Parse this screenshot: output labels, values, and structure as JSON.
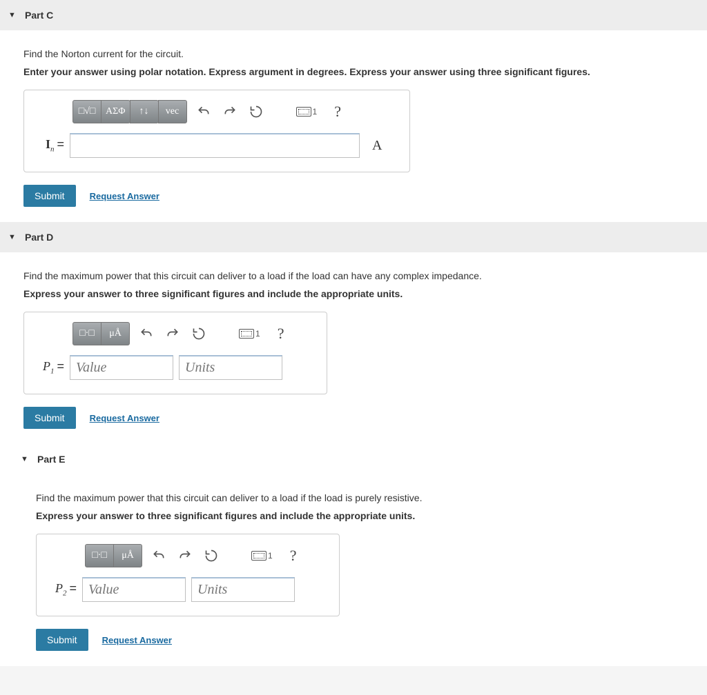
{
  "parts": {
    "c": {
      "title": "Part C",
      "question": "Find the Norton current for the circuit.",
      "instruction": "Enter your answer using polar notation. Express argument in degrees. Express your answer using three significant figures.",
      "var_symbol": "I",
      "var_sub": "n",
      "unit_suffix": "A",
      "toolbar": {
        "templates": "□√□",
        "greek": "ΑΣΦ",
        "arrows": "↑↓",
        "vec": "vec"
      }
    },
    "d": {
      "title": "Part D",
      "question": "Find the maximum power that this circuit can deliver to a load if the load can have any complex impedance.",
      "instruction": "Express your answer to three significant figures and include the appropriate units.",
      "var_symbol": "P",
      "var_sub": "1",
      "value_placeholder": "Value",
      "units_placeholder": "Units"
    },
    "e": {
      "title": "Part E",
      "question": "Find the maximum power that this circuit can deliver to a load if the load  is purely resistive.",
      "instruction": "Express your answer to three significant figures and include the appropriate units.",
      "var_symbol": "P",
      "var_sub": "2",
      "value_placeholder": "Value",
      "units_placeholder": "Units"
    }
  },
  "common": {
    "submit": "Submit",
    "request": "Request Answer",
    "help": "?",
    "keyboard_label": "1"
  }
}
